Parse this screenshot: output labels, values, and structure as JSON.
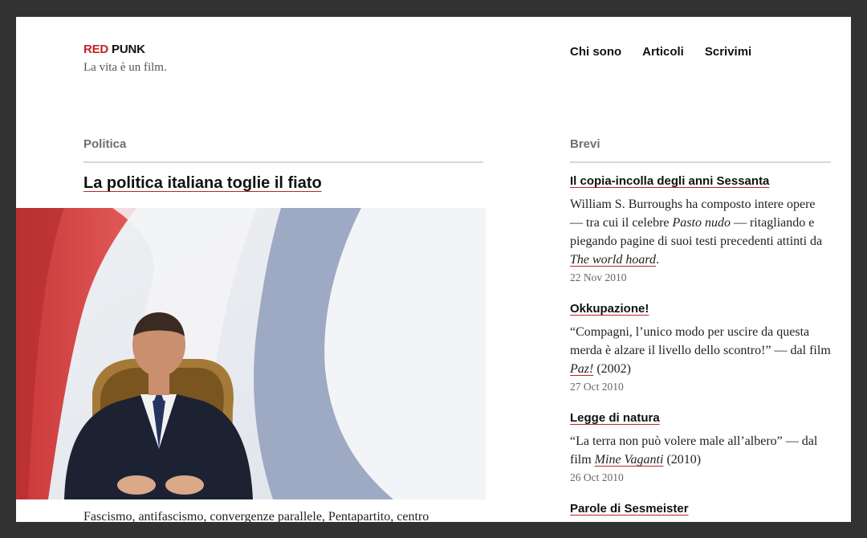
{
  "site": {
    "logo_part1": "RED",
    "logo_part2": "PUNK",
    "tagline": "La vita è un film.",
    "accent_color": "#c0232b"
  },
  "nav": [
    "Chi sono",
    "Articoli",
    "Scrivimi"
  ],
  "main": {
    "section": "Politica",
    "title": "La politica italiana toglie il fiato",
    "image_icon": "photo-man-sleeping-in-front-of-italian-flag",
    "excerpt": "Fascismo, antifascismo, convergenze parallele, Pentapartito, centro"
  },
  "sidebar": {
    "section": "Brevi",
    "items": [
      {
        "title": "Il copia-incolla degli anni Sessanta",
        "text1": "William S. Burroughs ha composto intere opere — tra cui il celebre ",
        "em1": "Pasto nudo",
        "text2": " — ritagliando e piegando pagine di suoi testi precedenti attinti da ",
        "link": "The world hoard",
        "text3": ".",
        "date": "22 Nov 2010"
      },
      {
        "title": "Okkupazione!",
        "text1": "“Compagni, l’unico modo per uscire da questa merda è alzare il livello dello scontro!” — dal film ",
        "link": "Paz!",
        "text3": " (2002)",
        "date": "27 Oct 2010"
      },
      {
        "title": "Legge di natura",
        "text1": "“La terra non può volere male all’albero” — dal film ",
        "link": "Mine Vaganti",
        "text3": " (2010)",
        "date": "26 Oct 2010"
      },
      {
        "title": "Parole di Sesmeister"
      }
    ]
  }
}
